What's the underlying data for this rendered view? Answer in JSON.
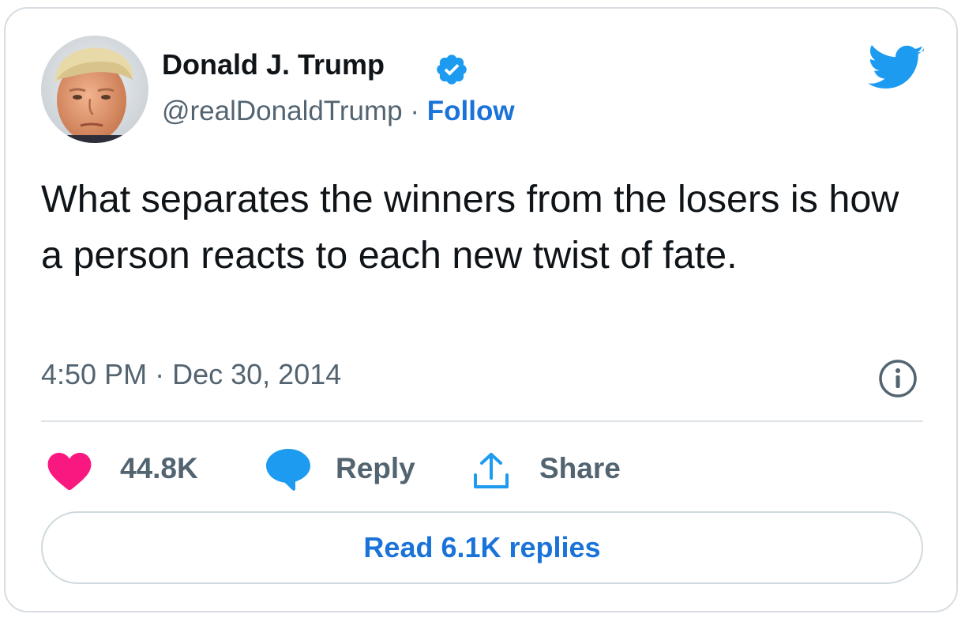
{
  "user": {
    "display_name": "Donald J. Trump",
    "handle": "@realDonaldTrump",
    "separator": "·",
    "follow_label": "Follow",
    "verified": true
  },
  "tweet": {
    "text": "What separates the winners from the losers is how a person reacts to each new twist of fate.",
    "time": "4:50 PM",
    "date_separator": "·",
    "date": "Dec 30, 2014"
  },
  "actions": {
    "likes_count": "44.8K",
    "reply_label": "Reply",
    "share_label": "Share"
  },
  "read_replies_label": "Read 6.1K replies",
  "icons": {
    "avatar": "profile-photo",
    "verified": "verified-badge-icon",
    "logo": "twitter-bird-icon",
    "info": "info-icon",
    "like": "heart-icon",
    "reply": "speech-bubble-icon",
    "share": "share-upload-icon"
  },
  "colors": {
    "text": "#0f1419",
    "secondary": "#536471",
    "link": "#1a73d9",
    "twitter_blue": "#1d9bf0",
    "heart": "#f91880",
    "border": "#d7dde2"
  }
}
